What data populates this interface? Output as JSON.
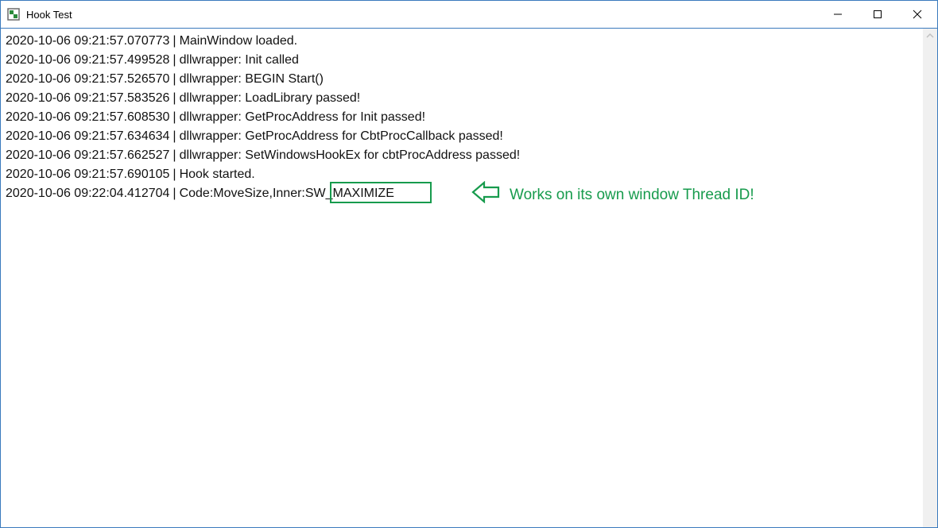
{
  "window": {
    "title": "Hook Test"
  },
  "log": {
    "separator": "|",
    "lines": [
      {
        "ts": "2020-10-06 09:21:57.070773",
        "msg": "MainWindow loaded."
      },
      {
        "ts": "2020-10-06 09:21:57.499528",
        "msg": "dllwrapper: Init called"
      },
      {
        "ts": "2020-10-06 09:21:57.526570",
        "msg": "dllwrapper: BEGIN Start()"
      },
      {
        "ts": "2020-10-06 09:21:57.583526",
        "msg": "dllwrapper: LoadLibrary passed!"
      },
      {
        "ts": "2020-10-06 09:21:57.608530",
        "msg": "dllwrapper: GetProcAddress for Init passed!"
      },
      {
        "ts": "2020-10-06 09:21:57.634634",
        "msg": "dllwrapper: GetProcAddress for CbtProcCallback passed!"
      },
      {
        "ts": "2020-10-06 09:21:57.662527",
        "msg": "dllwrapper: SetWindowsHookEx for cbtProcAddress passed!"
      },
      {
        "ts": "2020-10-06 09:21:57.690105",
        "msg": "Hook started."
      },
      {
        "ts": "2020-10-06 09:22:04.412704",
        "msg": "Code:MoveSize,Inner:SW_MAXIMIZE"
      }
    ]
  },
  "annotation": {
    "text": "Works on its own window Thread ID!"
  },
  "highlight": {
    "text": "SW_MAXIMIZE"
  }
}
